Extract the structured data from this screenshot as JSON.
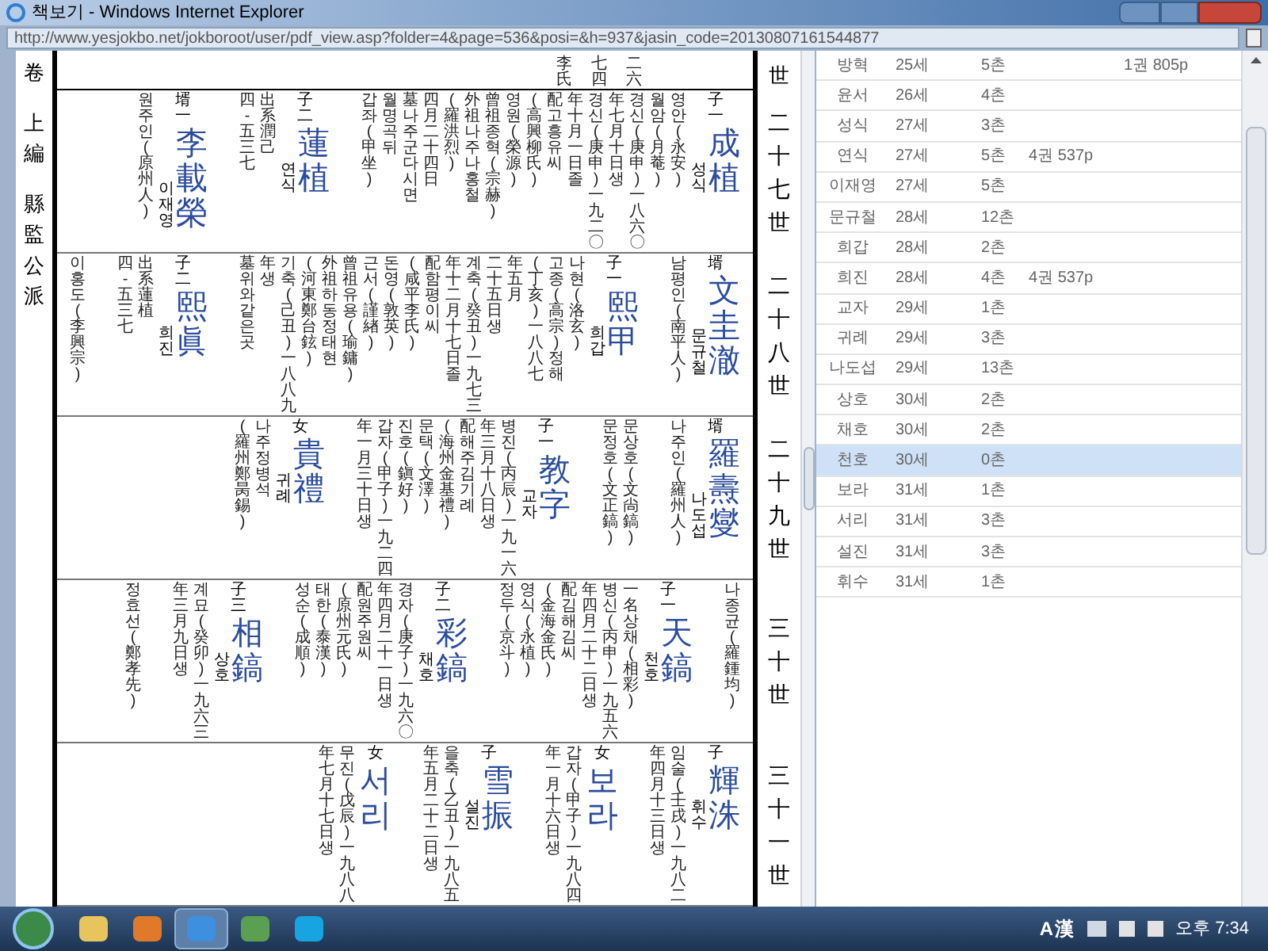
{
  "window": {
    "title": "책보기 - Windows Internet Explorer"
  },
  "address_bar": {
    "url": "http://www.yesjokbo.net/jokboroot/user/pdf_view.asp?folder=4&page=536&posi=&h=937&jasin_code=20130807161544877"
  },
  "document": {
    "margin_left": [
      "卷",
      "上編",
      "縣監公派"
    ],
    "top_strip": {
      "label": "世",
      "lines": [
        "李氏",
        "七四",
        "二六"
      ]
    },
    "generations": [
      {
        "label": "二十七世",
        "entries": [
          {
            "relation": "壻一",
            "name": "李載榮",
            "reading": "이재영",
            "lines": [
              "원주인(原州人)"
            ]
          },
          {
            "relation": "子二",
            "name": "蓮植",
            "reading": "연식",
            "lines": [
              "四-五三七",
              "出系潤己"
            ]
          },
          {
            "relation": "子一",
            "name": "成植",
            "reading": "성식",
            "lines": [
              "갑좌(甲坐)",
              "월명곡 뒤",
              "墓나주군 다시면",
              "四月二十四日",
              "(羅洪烈)",
              "外祖나주나홍철",
              "曾祖종혁(宗赫)",
              "영원(榮源)",
              "(高興柳氏)",
              "配고흥유씨",
              "年十月一日졸",
              "경신(庚申)一九二〇",
              "年七月十日생",
              "경신(庚申)一八六〇",
              "월암(月菴)",
              "영안(永安)"
            ]
          }
        ]
      },
      {
        "label": "二十八世",
        "entries": [
          {
            "lines": [
              "이홍도(李興宗)"
            ]
          },
          {
            "relation": "子二",
            "name": "熙眞",
            "reading": "희진",
            "lines": [
              "四-五三七",
              "出系蓮植"
            ]
          },
          {
            "relation": "子一",
            "name": "熙甲",
            "reading": "희갑",
            "lines": [
              "墓위와 같은곳",
              "年생",
              "기축(己丑)一八八九",
              "(河東鄭台鉉)",
              "外祖하동정태현",
              "曾祖유용(瑜鏞)",
              "근서(謹緖)",
              "돈영(敦英)",
              "(咸平李氏)",
              "配함평이씨",
              "年十二月十七日졸",
              "계축(癸丑)一九七三",
              "二十五日생",
              "年五月",
              "(丁亥)一八八七",
              "고종(高宗) 정해",
              "나현(洛玄)"
            ]
          },
          {
            "relation": "壻",
            "name": "文圭澈",
            "reading": "문규철",
            "lines": [
              "남평인(南平人)"
            ]
          }
        ]
      },
      {
        "label": "二十九世",
        "entries": [
          {
            "relation": "女",
            "name": "貴禮",
            "reading": "귀례",
            "lines": [
              "(羅州鄭昺錫)",
              "나주정병석"
            ]
          },
          {
            "relation": "子一",
            "name": "教字",
            "reading": "교자",
            "lines": [
              "年一月三十日생",
              "갑자(甲子)一九二四",
              "진호(鎭好)",
              "문택(文澤)",
              "(海州金基禮)",
              "配해주김기례",
              "年三月十八日생",
              "병진(丙辰)一九一六"
            ]
          },
          {
            "lines": [
              "문정호(文正鎬)",
              "문상호(文尙鎬)"
            ]
          },
          {
            "relation": "壻",
            "name": "羅燾燮",
            "reading": "나도섭",
            "lines": [
              "나주인(羅州人)"
            ]
          }
        ]
      },
      {
        "label": "三十世",
        "entries": [
          {
            "lines": [
              "정효선(鄭孝先)"
            ]
          },
          {
            "relation": "子三",
            "name": "相鎬",
            "reading": "상호",
            "lines": [
              "年三月九日생",
              "계묘(癸卯)一九六三"
            ]
          },
          {
            "relation": "子二",
            "name": "彩鎬",
            "reading": "채호",
            "lines": [
              "성순(成順)",
              "태한(泰漢)",
              "(原州元氏)",
              "配원주원씨",
              "年四月二十一日생",
              "경자(庚子)一九六〇"
            ]
          },
          {
            "relation": "子一",
            "name": "天鎬",
            "reading": "천호",
            "lines": [
              "정두(京斗)",
              "영식(永植)",
              "(金海金氏)",
              "配김해김씨",
              "年四月二十二日생",
              "병신(丙申)一九五六",
              "一名상채(相彩)"
            ]
          },
          {
            "lines": [
              "나종균(羅鍾均)"
            ]
          }
        ]
      },
      {
        "label": "三十一世",
        "entries": [
          {
            "relation": "女",
            "name": "서리",
            "lines": [
              "年七月十七日생",
              "무진(戊辰)一九八八"
            ]
          },
          {
            "relation": "子",
            "name": "雪振",
            "reading": "설진",
            "lines": [
              "年五月二十二日생",
              "을축(乙丑)一九八五"
            ]
          },
          {
            "relation": "女",
            "name": "보라",
            "lines": [
              "年一月十六日생",
              "갑자(甲子)一九八四"
            ]
          },
          {
            "relation": "子",
            "name": "輝洙",
            "reading": "휘수",
            "lines": [
              "年四月十三日생",
              "임술(壬戌)一九八二"
            ]
          }
        ]
      }
    ]
  },
  "relatives_list": {
    "rows": [
      {
        "name": "방혁",
        "generation": "25세",
        "chon": "5촌",
        "column_5": "1권 805p",
        "selected": false
      },
      {
        "name": "윤서",
        "generation": "26세",
        "chon": "4촌",
        "selected": false
      },
      {
        "name": "성식",
        "generation": "27세",
        "chon": "3촌",
        "selected": false
      },
      {
        "name": "연식",
        "generation": "27세",
        "chon": "5촌",
        "column_4": "4권 537p",
        "selected": false
      },
      {
        "name": "이재영",
        "generation": "27세",
        "chon": "5촌",
        "selected": false
      },
      {
        "name": "문규철",
        "generation": "28세",
        "chon": "12촌",
        "selected": false
      },
      {
        "name": "희갑",
        "generation": "28세",
        "chon": "2촌",
        "selected": false
      },
      {
        "name": "희진",
        "generation": "28세",
        "chon": "4촌",
        "column_4": "4권 537p",
        "selected": false
      },
      {
        "name": "교자",
        "generation": "29세",
        "chon": "1촌",
        "selected": false
      },
      {
        "name": "귀례",
        "generation": "29세",
        "chon": "3촌",
        "selected": false
      },
      {
        "name": "나도섭",
        "generation": "29세",
        "chon": "13촌",
        "selected": false
      },
      {
        "name": "상호",
        "generation": "30세",
        "chon": "2촌",
        "selected": false
      },
      {
        "name": "채호",
        "generation": "30세",
        "chon": "2촌",
        "selected": false
      },
      {
        "name": "천호",
        "generation": "30세",
        "chon": "0촌",
        "selected": true
      },
      {
        "name": "보라",
        "generation": "31세",
        "chon": "1촌",
        "selected": false
      },
      {
        "name": "서리",
        "generation": "31세",
        "chon": "3촌",
        "selected": false
      },
      {
        "name": "설진",
        "generation": "31세",
        "chon": "3촌",
        "selected": false
      },
      {
        "name": "휘수",
        "generation": "31세",
        "chon": "1촌",
        "selected": false
      }
    ]
  },
  "taskbar": {
    "ime": [
      "A",
      "漢"
    ],
    "clock": "오후 7:34"
  }
}
